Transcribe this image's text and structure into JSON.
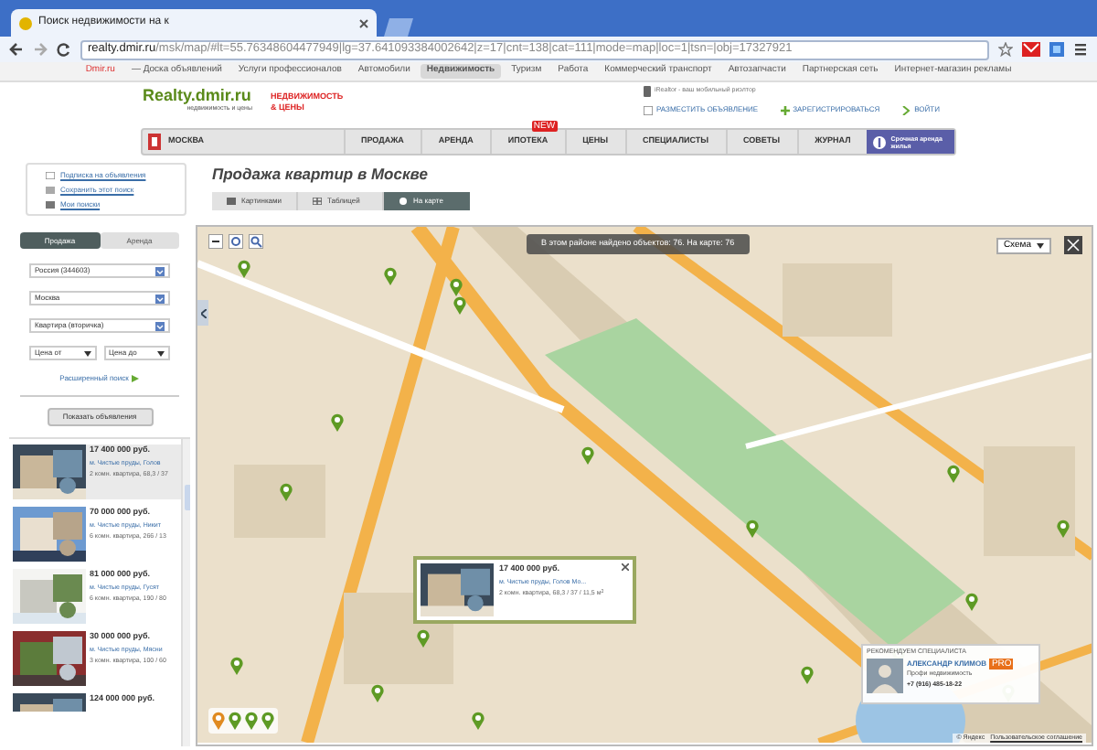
{
  "browser": {
    "tab_title": "Поиск недвижимости на к",
    "url_host": "realty.dmir.ru",
    "url_path": "/msk/map/#lt=55.76348604477949|lg=37.641093384002642|z=17|cnt=138|cat=111|mode=map|loc=1|tsn=|obj=17327921",
    "bookmarks": [
      {
        "label": "Dmir.ru",
        "selected": false,
        "kind": "brand"
      },
      {
        "label": "— Доска объявлений",
        "selected": false,
        "kind": "link"
      },
      {
        "label": "Услуги профессионалов",
        "selected": false,
        "kind": "link"
      },
      {
        "label": "Автомобили",
        "selected": false,
        "kind": "link"
      },
      {
        "label": "Недвижимость",
        "selected": true,
        "kind": "link"
      },
      {
        "label": "Туризм",
        "selected": false,
        "kind": "link"
      },
      {
        "label": "Работа",
        "selected": false,
        "kind": "link"
      },
      {
        "label": "Коммерческий транспорт",
        "selected": false,
        "kind": "link"
      },
      {
        "label": "Автозапчасти",
        "selected": false,
        "kind": "link"
      },
      {
        "label": "Партнерская сеть",
        "selected": false,
        "kind": "link"
      },
      {
        "label": "Интернет-магазин рекламы",
        "selected": false,
        "kind": "link"
      }
    ]
  },
  "header": {
    "logo": "Realty.dmir.ru",
    "tagline": "недвижимость и цены",
    "logo_2": "НЕДВИЖИМОСТЬ & ЦЕНЫ",
    "app_promo": "iRealtor - ваш мобильный риэлтор",
    "actions": [
      "РАЗМЕСТИТЬ ОБЪЯВЛЕНИЕ",
      "ЗАРЕГИСТРИРОВАТЬСЯ",
      "ВОЙТИ"
    ]
  },
  "nav": {
    "city": "МОСКВА",
    "items": [
      {
        "label": "ПРОДАЖА"
      },
      {
        "label": "АРЕНДА"
      },
      {
        "label": "ИПОТЕКА",
        "badge": "NEW"
      },
      {
        "label": "ЦЕНЫ"
      },
      {
        "label": "СПЕЦИАЛИСТЫ"
      },
      {
        "label": "СОВЕТЫ"
      },
      {
        "label": "ЖУРНАЛ"
      }
    ],
    "promo": "Срочная аренда жилья"
  },
  "search_links": [
    "Подписка на объявления",
    "Сохранить этот поиск",
    "Мои поиски"
  ],
  "page_title": "Продажа квартир в Москве",
  "view_tabs": [
    {
      "label": "Картинками",
      "selected": false
    },
    {
      "label": "Таблицей",
      "selected": false
    },
    {
      "label": "На карте",
      "selected": true
    }
  ],
  "filters": {
    "deal_tabs": [
      {
        "label": "Продажа",
        "selected": true
      },
      {
        "label": "Аренда",
        "selected": false
      }
    ],
    "selects": [
      "Россия (344603)",
      "Москва",
      "Квартира (вторичка)"
    ],
    "price_from": "Цена от",
    "price_to": "Цена до",
    "advanced_link": "Расширенный поиск",
    "submit": "Показать объявления"
  },
  "listings": [
    {
      "price": "17 400 000 руб.",
      "address": "м. Чистые пруды, Голов",
      "details": "2 комн. квартира, 68,3 / 37"
    },
    {
      "price": "70 000 000 руб.",
      "address": "м. Чистые пруды, Никит",
      "details": "6 комн. квартира, 266 / 13"
    },
    {
      "price": "81 000 000 руб.",
      "address": "м. Чистые пруды, Гусят",
      "details": "6 комн. квартира, 190 / 80"
    },
    {
      "price": "30 000 000 руб.",
      "address": "м. Чистые пруды, Мясни",
      "details": "3 комн. квартира, 100 / 60"
    },
    {
      "price": "124 000 000 руб."
    }
  ],
  "map": {
    "count_text": "В этом районе найдено объектов: 76. На карте: 76",
    "layer": "Схема",
    "popup": {
      "price": "17 400 000 руб.",
      "address": "м. Чистые пруды, Голов Мо...",
      "details": "2 комн. квартира, 68,3 / 37 / 11,5 м$^{2}$"
    },
    "specialist": {
      "heading": "РЕКОМЕНДУЕМ СПЕЦИАЛИСТА",
      "name": "АЛЕКСАНДР КЛИМОВ",
      "badge": "PRO",
      "company": "Профи недвижимость",
      "phone": "+7 (916) 485-18-22"
    },
    "copyright": "© Яндекс",
    "terms": "Пользовательское соглашение"
  }
}
